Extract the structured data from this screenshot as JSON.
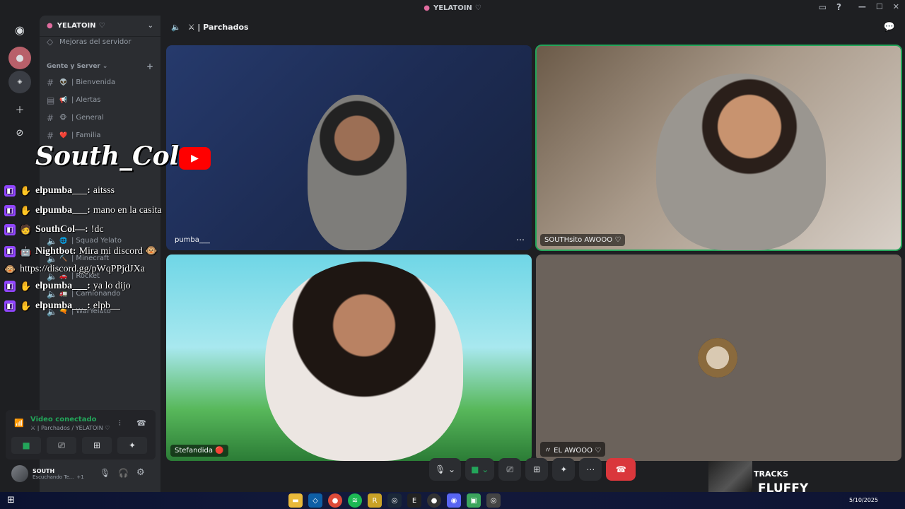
{
  "window": {
    "title": "YELATOIN",
    "heart": "♡"
  },
  "server": {
    "name": "YELATOIN",
    "partial_item": "Mejoras del servidor",
    "category": "Gente y Server",
    "text_channels": [
      {
        "emoji": "👽",
        "name": "Bienvenida",
        "icon": "#"
      },
      {
        "emoji": "📢",
        "name": "Alertas",
        "icon": "▤"
      },
      {
        "emoji": "🐵",
        "name": "General",
        "icon": "#"
      },
      {
        "emoji": "❤️",
        "name": "Familia",
        "icon": "#"
      }
    ],
    "voice_channels": [
      {
        "emoji": "🌐",
        "name": "Squad Yelato"
      },
      {
        "emoji": "⛏️",
        "name": "Minecraft"
      },
      {
        "emoji": "🚗",
        "name": "Rocket"
      },
      {
        "emoji": "🚛",
        "name": "Camionando"
      },
      {
        "emoji": "🔫",
        "name": "WarYelato"
      }
    ]
  },
  "voice_panel": {
    "status": "Video conectado",
    "location": "⚔ | Parchados / YELATOIN ♡"
  },
  "user_panel": {
    "name": "SOUTH",
    "activity": "Escuchando Te...",
    "extra": "+1"
  },
  "stage": {
    "channel": "⚔ | Parchados",
    "tiles": [
      {
        "label": "pumba___"
      },
      {
        "label": "SOUTHsito AWOOO ♡"
      },
      {
        "label": "Stefandida 🔴"
      },
      {
        "label": "〃 EL AWOOO ♡"
      }
    ]
  },
  "overlay": {
    "streamer": "South_Col",
    "chat": [
      {
        "user": "elpumba___:",
        "text": "aitsss",
        "badge": "✋"
      },
      {
        "user": "elpumba___:",
        "text": "mano en la casita",
        "badge": "✋"
      },
      {
        "user": "SouthCol—:",
        "text": "!dc",
        "badge": "🧑"
      },
      {
        "user": "Nightbot:",
        "text": "Mira mi discord 🐵",
        "badge": "🤖"
      },
      {
        "user": "",
        "text": "https://discord.gg/pWqPPjdJXa",
        "badge": "🐵"
      },
      {
        "user": "elpumba___:",
        "text": "ya lo dijo",
        "badge": "✋"
      },
      {
        "user": "elpumba___:",
        "text": "elpb__",
        "badge": "✋"
      }
    ],
    "tracks_label": "TRACKS",
    "song": "FLUFFY"
  },
  "taskbar": {
    "date": "5/10/2025"
  },
  "colors": {
    "accent": "#23a55a",
    "end_call": "#da373c",
    "twitch": "#9146ff",
    "youtube": "#ff0000"
  }
}
